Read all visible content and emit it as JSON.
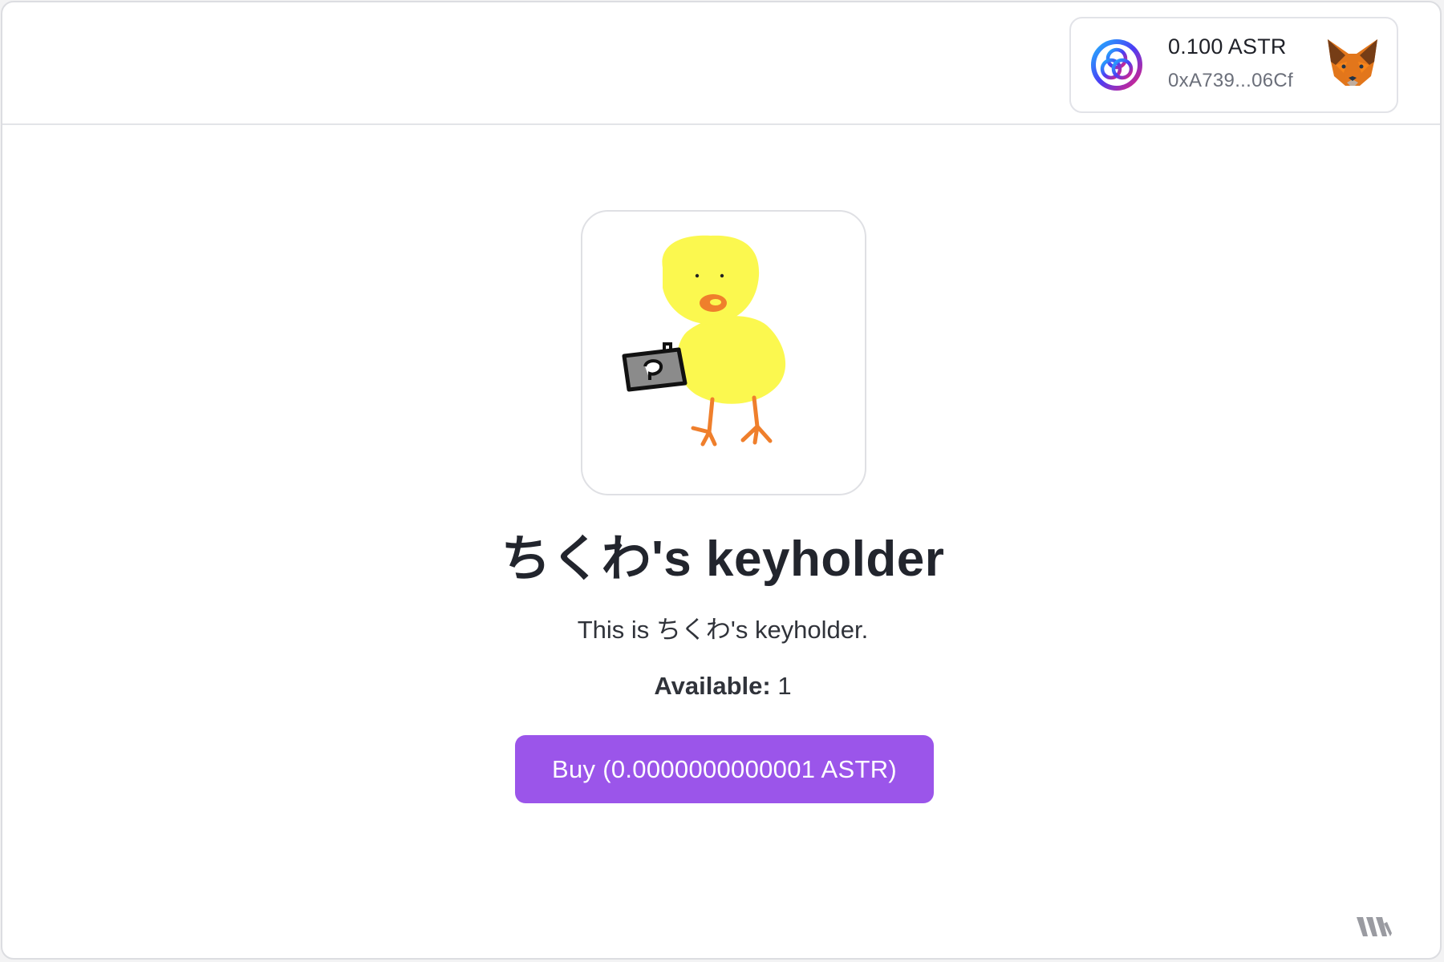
{
  "wallet": {
    "balance": "0.100 ASTR",
    "address": "0xA739...06Cf",
    "network_icon": "astar-network-icon",
    "wallet_icon": "metamask-fox-icon"
  },
  "item": {
    "image_icon": "chick-with-camera-image",
    "title": "ちくわ's keyholder",
    "description": "This is ちくわ's keyholder.",
    "available_label": "Available:",
    "available_value": "1",
    "buy_label": "Buy (0.0000000000001 ASTR)"
  },
  "footer": {
    "brand_icon": "brand-logo-icon"
  },
  "colors": {
    "accent": "#9b55ea",
    "chick": "#fbf84f",
    "beak": "#ef7f2c",
    "text": "#22252d"
  }
}
